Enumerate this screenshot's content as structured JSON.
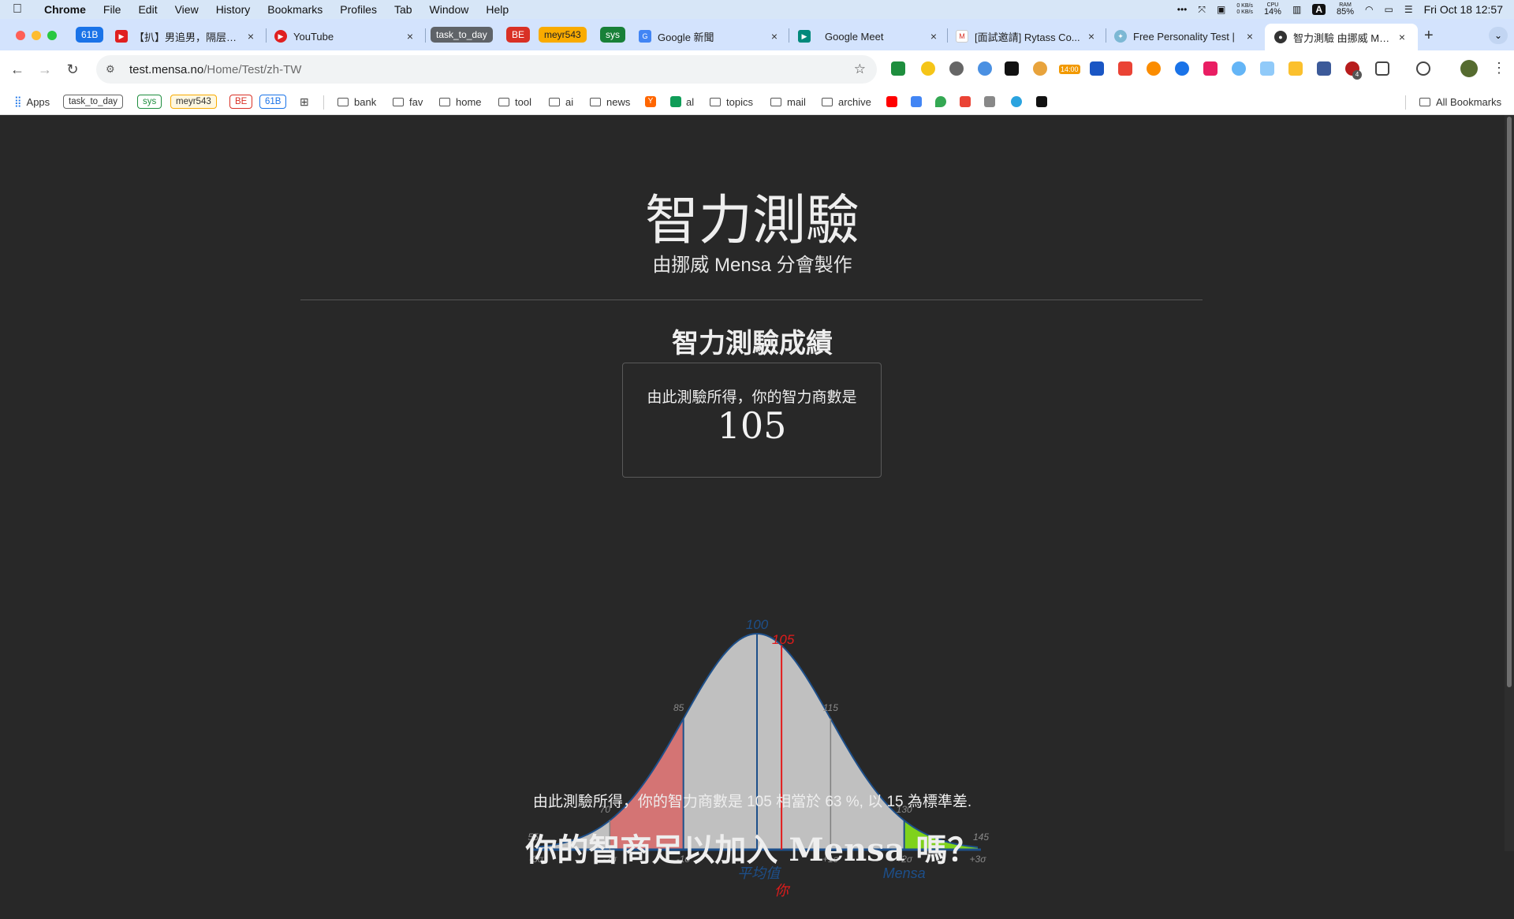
{
  "menubar": {
    "app": "Chrome",
    "items": [
      "File",
      "Edit",
      "View",
      "History",
      "Bookmarks",
      "Profiles",
      "Tab",
      "Window",
      "Help"
    ],
    "net_up": "0 KB/s",
    "net_down": "0 KB/s",
    "cpu_label": "CPU",
    "cpu": "14%",
    "ram_label": "RAM",
    "ram": "85%",
    "input_source": "A",
    "datetime": "Fri Oct 18  12:57"
  },
  "tabs": {
    "group_61b": "61B",
    "tab1": "【扒】男追男，隔层纱 -",
    "tab2": "YouTube",
    "group_task": "task_to_day",
    "group_be": "BE",
    "group_meyr": "meyr543",
    "group_sys": "sys",
    "tab3": "Google 新聞",
    "tab4": "Google Meet",
    "tab5": "[面試邀請] Rytass Co...",
    "tab6": "Free Personality Test |",
    "tab7": "智力測驗 由挪威 Mensa",
    "new_tab": "+"
  },
  "toolbar": {
    "url_host": "test.mensa.no",
    "url_path": "/Home/Test/zh-TW",
    "clock_badge": "14:00",
    "ext_badge": "4"
  },
  "bookmarks": {
    "apps": "Apps",
    "tags": [
      "task_to_day",
      "sys",
      "meyr543",
      "BE",
      "61B"
    ],
    "folders": [
      "bank",
      "fav",
      "home",
      "tool",
      "ai",
      "news"
    ],
    "y_label": "Y",
    "al": "al",
    "folders2": [
      "topics",
      "mail",
      "archive"
    ],
    "all": "All Bookmarks"
  },
  "page": {
    "title": "智力測驗",
    "subtitle": "由挪威 Mensa 分會製作",
    "result_heading": "智力測驗成績",
    "score_caption": "由此測驗所得，你的智力商數是",
    "score": "105",
    "result_text": "由此測驗所得，你的智力商數是 105 相當於 63 %, 以 15 為標準差.",
    "cta_heading": "你的智商足以加入 Mensa 嗎？"
  },
  "chart_data": {
    "type": "area",
    "distribution": "normal",
    "mean": 100,
    "sd": 15,
    "xlim": [
      55,
      145
    ],
    "iq_labels": [
      "55",
      "70",
      "85",
      "115",
      "130",
      "145"
    ],
    "sigma_labels": [
      "-3σ",
      "-2σ",
      "-1σ",
      "+1σ",
      "+2σ",
      "+3σ"
    ],
    "mean_label": "100",
    "you_value": 105,
    "you_label": "105",
    "mean_caption": "平均值",
    "you_caption": "你",
    "mensa_caption": "Mensa",
    "percentile": 63,
    "regions": [
      {
        "from": 70,
        "to": 85,
        "color": "#d47474"
      },
      {
        "from": 130,
        "to": 145,
        "color": "#7fd21c"
      }
    ],
    "colors": {
      "curve": "#1d4f8a",
      "fill": "#c0c0c0",
      "you": "#e21b1b",
      "mean": "#1d4f8a",
      "divider": "#808080"
    }
  },
  "colors": {
    "page_bg": "#282828",
    "tabstrip_bg": "#d3e3fd",
    "menubar_bg": "#d7e6f7"
  }
}
